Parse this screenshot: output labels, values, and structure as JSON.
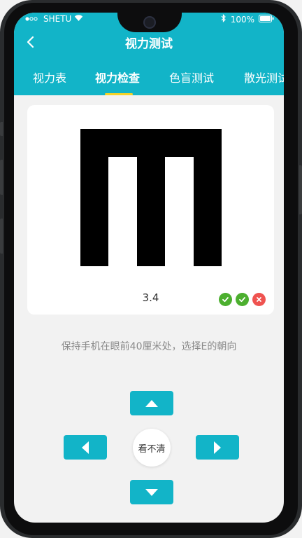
{
  "status_bar": {
    "carrier": "SHETU",
    "battery": "100%"
  },
  "header": {
    "title": "视力测试",
    "back_icon": "chevron-left-icon"
  },
  "tabs": [
    {
      "label": "视力表",
      "active": false
    },
    {
      "label": "视力检查",
      "active": true
    },
    {
      "label": "色盲测试",
      "active": false
    },
    {
      "label": "散光测试",
      "active": false
    }
  ],
  "test_card": {
    "optotype": "E",
    "optotype_direction": "down",
    "acuity_value": "3.4",
    "results": [
      "correct",
      "correct",
      "wrong"
    ]
  },
  "instruction": "保持手机在眼前40厘米处，选择E的朝向",
  "controls": {
    "up_icon": "triangle-up-icon",
    "left_icon": "triangle-left-icon",
    "right_icon": "triangle-right-icon",
    "down_icon": "triangle-down-icon",
    "cannot_see_label": "看不清"
  },
  "colors": {
    "accent": "#12b4c8",
    "tab_indicator": "#f5d327",
    "correct": "#4caf2f",
    "wrong": "#ef5350"
  }
}
